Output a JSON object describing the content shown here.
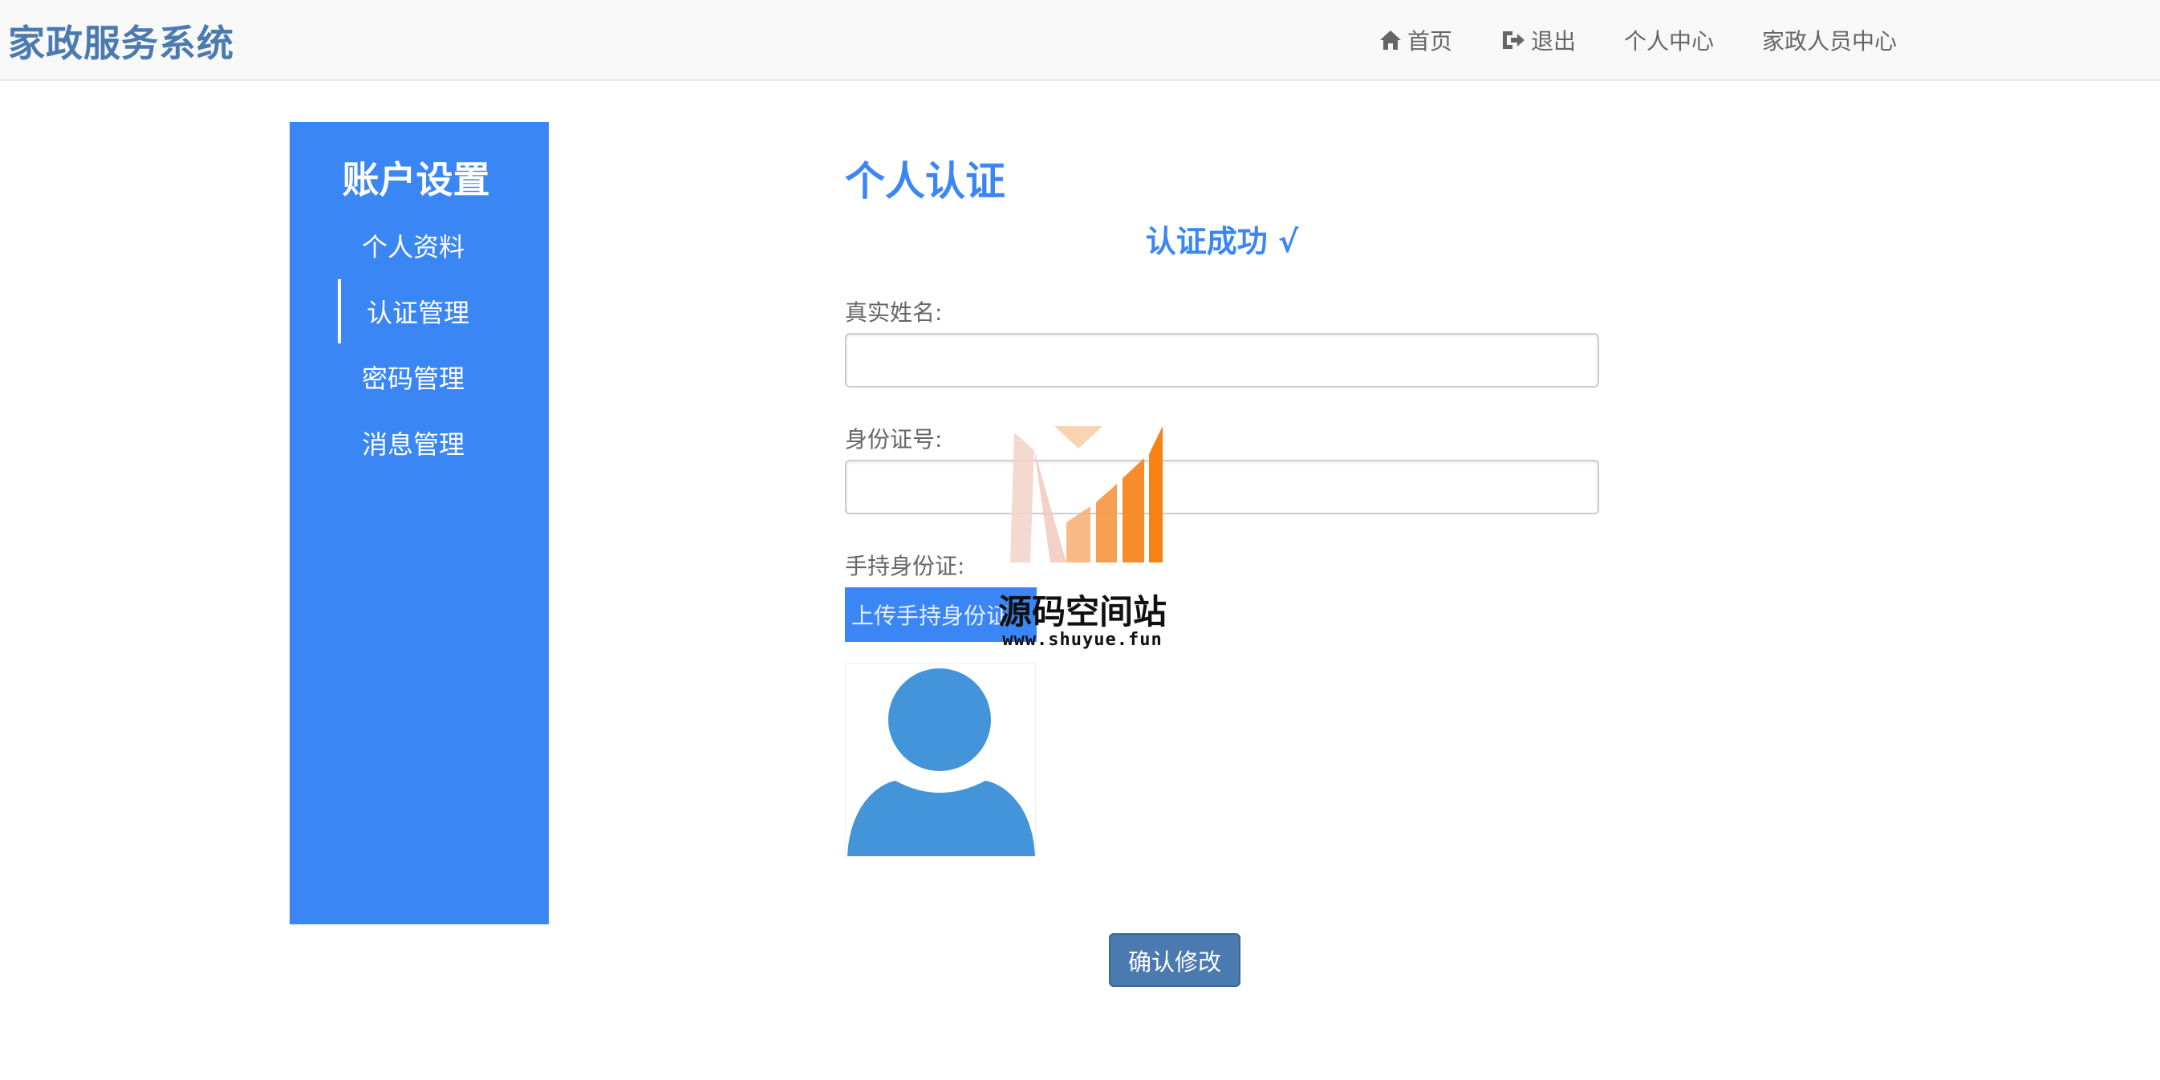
{
  "header": {
    "brand": "家政服务系统",
    "nav": {
      "home": "首页",
      "logout": "退出",
      "personal_center": "个人中心",
      "staff_center": "家政人员中心"
    }
  },
  "sidebar": {
    "title": "账户设置",
    "items": [
      {
        "label": "个人资料",
        "active": false
      },
      {
        "label": "认证管理",
        "active": true
      },
      {
        "label": "密码管理",
        "active": false
      },
      {
        "label": "消息管理",
        "active": false
      }
    ]
  },
  "main": {
    "title": "个人认证",
    "status": "认证成功 √",
    "fields": {
      "real_name_label": "真实姓名:",
      "real_name_value": "",
      "id_number_label": "身份证号:",
      "id_number_value": "",
      "id_photo_label": "手持身份证:"
    },
    "upload_button": "上传手持身份证",
    "confirm_button": "确认修改"
  },
  "watermark": {
    "name": "源码空间站",
    "url": "www.shuyue.fun"
  },
  "colors": {
    "primary": "#3b86f5",
    "brand": "#4a7ab0",
    "avatar": "#4394d8"
  },
  "icons": {
    "home": "home-icon",
    "logout": "logout-icon"
  }
}
